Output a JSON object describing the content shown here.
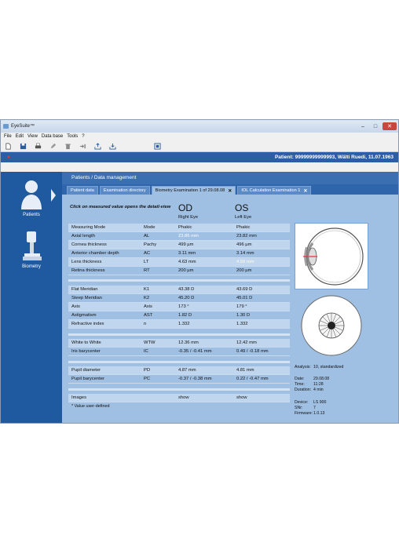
{
  "window": {
    "title": "EyeSuite™"
  },
  "menu": [
    "File",
    "Edit",
    "View",
    "Data base",
    "Tools",
    "?"
  ],
  "patient_bar": {
    "patient": "Patient: 99999999999993, Wälti Ruedi, 11.07.1963"
  },
  "sidebar": {
    "patients_label": "Patients",
    "biometry_label": "Biometry"
  },
  "breadcrumb": "Patients / Data management",
  "tabs": [
    {
      "label": "Patient data"
    },
    {
      "label": "Examination directory"
    },
    {
      "label": "Biometry Examination 1 of 29.08.08"
    },
    {
      "label": "IOL Calculation Examination 1"
    }
  ],
  "hint": "Click on measured value opens the detail-view",
  "od": {
    "title": "OD",
    "subtitle": "Right Eye"
  },
  "os": {
    "title": "OS",
    "subtitle": "Left Eye"
  },
  "rows": [
    {
      "name": "Measuring Mode",
      "mode": "Mode",
      "od": "Phakic",
      "os": "Phakic"
    },
    {
      "name": "Axial length",
      "mode": "AL",
      "od": "23.86 mm",
      "os": "23.82 mm"
    },
    {
      "name": "Cornea thickness",
      "mode": "Pachy",
      "od": "499 µm",
      "os": "496 µm"
    },
    {
      "name": "Anterior chamber depth",
      "mode": "AC",
      "od": "3.11 mm",
      "os": "3.14 mm"
    },
    {
      "name": "Lens thickness",
      "mode": "LT",
      "od": "4.63 mm",
      "os": "4.59 mm"
    },
    {
      "name": "Retina thickness",
      "mode": "RT",
      "od": "200 µm",
      "os": "200 µm"
    },
    {
      "name": "Flat Meridian",
      "mode": "K1",
      "od": "43.38 D",
      "os": "43.69 D"
    },
    {
      "name": "Steep Meridian",
      "mode": "K2",
      "od": "45.20 D",
      "os": "45.01 D"
    },
    {
      "name": "Axis",
      "mode": "Axis",
      "od": "173 °",
      "os": "179 °"
    },
    {
      "name": "Astigmatism",
      "mode": "AST",
      "od": "1.82 D",
      "os": "1.30 D"
    },
    {
      "name": "Refractive index",
      "mode": "n",
      "od": "1.332",
      "os": "1.332"
    },
    {
      "name": "White to White",
      "mode": "WTW",
      "od": "12.36 mm",
      "os": "12.42 mm"
    },
    {
      "name": "Iris barycenter",
      "mode": "IC",
      "od": "-0.35 / -0.41 mm",
      "os": "0.49 / -0.18 mm"
    },
    {
      "name": "Pupil diameter",
      "mode": "PD",
      "od": "4.87 mm",
      "os": "4.81 mm"
    },
    {
      "name": "Pupil barycenter",
      "mode": "PC",
      "od": "-0.37 / -0.38 mm",
      "os": "0.22 / -0.47 mm"
    },
    {
      "name": "Images",
      "mode": "",
      "od": "show",
      "os": "show"
    }
  ],
  "footnote": "* Value user-defined",
  "analysis": {
    "analysis": "Analysis:",
    "analysis_v": "10, standardized",
    "date": "Date:",
    "date_v": "29.08.08",
    "time": "Time:",
    "time_v": "11:28",
    "duration": "Duration:",
    "duration_v": "4 min",
    "device": "Device:",
    "device_v": "LS 900",
    "snr": "SNr:",
    "snr_v": "7",
    "firmware": "Firmware:",
    "firmware_v": "1.0.13"
  },
  "colors": {
    "accent": "#2a5fa3",
    "panel": "#9fbfe3",
    "header_row": "#c0d6ee"
  }
}
